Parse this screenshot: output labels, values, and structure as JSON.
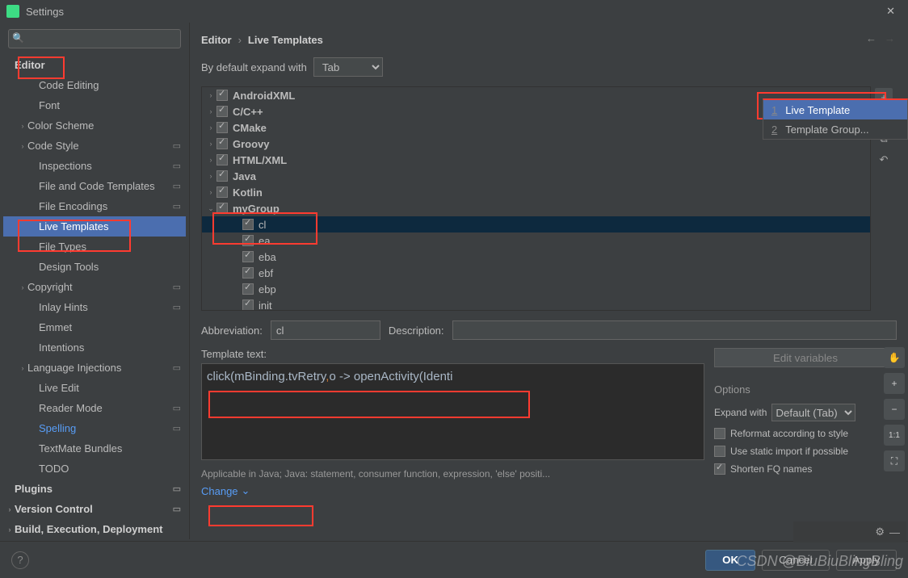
{
  "window": {
    "title": "Settings",
    "close": "✕"
  },
  "search": {
    "placeholder": ""
  },
  "sidebar": {
    "items": [
      {
        "label": "Editor",
        "cls": "bold",
        "chev": ""
      },
      {
        "label": "Code Editing",
        "cls": "ind2",
        "chev": ""
      },
      {
        "label": "Font",
        "cls": "ind2",
        "chev": ""
      },
      {
        "label": "Color Scheme",
        "cls": "ind1",
        "chev": "›"
      },
      {
        "label": "Code Style",
        "cls": "ind1",
        "chev": "›",
        "gear": true
      },
      {
        "label": "Inspections",
        "cls": "ind2",
        "chev": "",
        "gear": true
      },
      {
        "label": "File and Code Templates",
        "cls": "ind2",
        "chev": "",
        "gear": true
      },
      {
        "label": "File Encodings",
        "cls": "ind2",
        "chev": "",
        "gear": true
      },
      {
        "label": "Live Templates",
        "cls": "ind2 sel",
        "chev": ""
      },
      {
        "label": "File Types",
        "cls": "ind2",
        "chev": ""
      },
      {
        "label": "Design Tools",
        "cls": "ind2",
        "chev": ""
      },
      {
        "label": "Copyright",
        "cls": "ind1",
        "chev": "›",
        "gear": true
      },
      {
        "label": "Inlay Hints",
        "cls": "ind2",
        "chev": "",
        "gear": true
      },
      {
        "label": "Emmet",
        "cls": "ind2",
        "chev": ""
      },
      {
        "label": "Intentions",
        "cls": "ind2",
        "chev": ""
      },
      {
        "label": "Language Injections",
        "cls": "ind1",
        "chev": "›",
        "gear": true
      },
      {
        "label": "Live Edit",
        "cls": "ind2",
        "chev": ""
      },
      {
        "label": "Reader Mode",
        "cls": "ind2",
        "chev": "",
        "gear": true
      },
      {
        "label": "Spelling",
        "cls": "ind2 link",
        "chev": "",
        "gear": true
      },
      {
        "label": "TextMate Bundles",
        "cls": "ind2",
        "chev": ""
      },
      {
        "label": "TODO",
        "cls": "ind2",
        "chev": ""
      },
      {
        "label": "Plugins",
        "cls": "bold",
        "chev": "",
        "gear": true
      },
      {
        "label": "Version Control",
        "cls": "bold",
        "chev": "›",
        "gear": true
      },
      {
        "label": "Build, Execution, Deployment",
        "cls": "bold",
        "chev": "›"
      }
    ]
  },
  "crumbs": {
    "a": "Editor",
    "b": "Live Templates"
  },
  "expand": {
    "label": "By default expand with",
    "value": "Tab"
  },
  "templates": [
    {
      "name": "AndroidXML",
      "bold": true,
      "arr": "›",
      "ind": 0
    },
    {
      "name": "C/C++",
      "bold": true,
      "arr": "›",
      "ind": 0
    },
    {
      "name": "CMake",
      "bold": true,
      "arr": "›",
      "ind": 0
    },
    {
      "name": "Groovy",
      "bold": true,
      "arr": "›",
      "ind": 0
    },
    {
      "name": "HTML/XML",
      "bold": true,
      "arr": "›",
      "ind": 0
    },
    {
      "name": "Java",
      "bold": true,
      "arr": "›",
      "ind": 0
    },
    {
      "name": "Kotlin",
      "bold": true,
      "arr": "›",
      "ind": 0
    },
    {
      "name": "myGroup",
      "bold": true,
      "arr": "⌄",
      "ind": 0
    },
    {
      "name": "cl",
      "bold": false,
      "arr": "",
      "ind": 2,
      "sel": true
    },
    {
      "name": "ea",
      "bold": false,
      "arr": "",
      "ind": 2
    },
    {
      "name": "eba",
      "bold": false,
      "arr": "",
      "ind": 2
    },
    {
      "name": "ebf",
      "bold": false,
      "arr": "",
      "ind": 2
    },
    {
      "name": "ebp",
      "bold": false,
      "arr": "",
      "ind": 2
    },
    {
      "name": "init",
      "bold": false,
      "arr": "",
      "ind": 2
    }
  ],
  "form": {
    "abbr_label": "Abbreviation:",
    "abbr_value": "cl",
    "desc_label": "Description:",
    "desc_value": "",
    "tt_label": "Template text:",
    "editvars": "Edit variables",
    "applicable": "Applicable in Java; Java: statement, consumer function, expression, 'else' positi...",
    "change": "Change",
    "opts_title": "Options",
    "expandwith": "Expand with",
    "expand_value": "Default (Tab)",
    "opt1": "Reformat according to style",
    "opt2": "Use static import if possible",
    "opt3": "Shorten FQ names"
  },
  "code": {
    "pre": "click(mBinding.tvRetry",
    "comma": ",",
    "mid": "o -> openActivity(Identi"
  },
  "popup": {
    "i1": "Live Template",
    "i2": "Template Group...",
    "n1": "1",
    "n2": "2"
  },
  "footer": {
    "ok": "OK",
    "cancel": "Cancel",
    "apply": "Apply"
  },
  "watermark": "CSDN @BiuBiuBlingBling"
}
